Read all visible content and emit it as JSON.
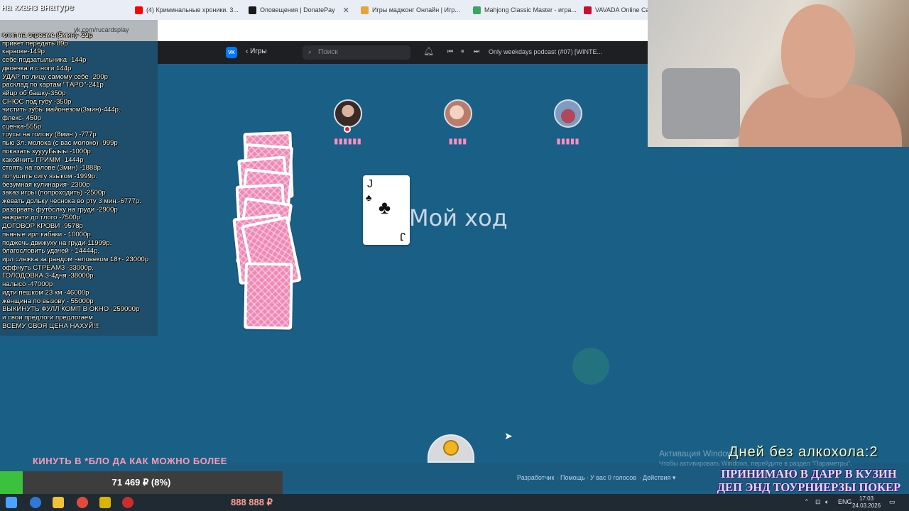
{
  "browser": {
    "tabs": [
      {
        "label": "клип на стрееме (5мин)- 29р",
        "favicon_color": "#5f6b78"
      },
      {
        "label": "(4) Криминальные хроники. 3...",
        "favicon_color": "#ff0000"
      },
      {
        "label": "Оповещения | DonatePay",
        "favicon_color": "#1a1a1a"
      },
      {
        "label": "Игры маджонг Онлайн | Игр...",
        "favicon_color": "#e8a33a"
      },
      {
        "label": "Mahjong Classic Master - игра...",
        "favicon_color": "#3aa55f"
      },
      {
        "label": "VAVADA Online Casi...",
        "favicon_color": "#c8102e"
      }
    ],
    "url": "vk.com/rucardsplay"
  },
  "vk_header": {
    "logo": "VK",
    "back_label": "Игры",
    "search_placeholder": "Поиск",
    "track": "Only weekdays podcast (#07) [WINTE..."
  },
  "game": {
    "players": [
      {
        "name": "▮▮▮▮▮▮",
        "active": true
      },
      {
        "name": "▮▮▮▮"
      },
      {
        "name": "▮▮▮▮▮"
      }
    ],
    "played_card": {
      "rank": "J",
      "suit": "♣"
    },
    "turn_label": "Мой ход"
  },
  "footer": {
    "links": [
      "Разработчик",
      "·",
      "Помощь",
      "·",
      "У вас 0 голосов",
      "·",
      "Действия ▾"
    ]
  },
  "stream_overlay": {
    "title": "на кханз внатуре",
    "price_list": [
      "клип на стрееме (5мин)- 29р",
      "привет передать 89р",
      "караоке-149р",
      "себе подзатыльника -144р",
      "двоечка и с ноги 144р",
      "УДАР по лицу самому себе -200р",
      "расклад по картам \"ТАРО\"-241р",
      "яйцо об башку-350р",
      "СНЮС под губу -350р",
      "чистить зубы майонезом(3мин)-444р.",
      "флекс- 450р",
      "сценка-555р",
      "трусы на голову (8мин ) -777р",
      "пью 3л. молока (с вас молоко) -999р",
      "показать зууууБыыы -1000р",
      "какойнить ГРИММ -1444р",
      "стоять на голове (3мин) -1888р.",
      "потушить сигу языком -1999р.",
      "безумная кулинария- 2300р",
      "заказ игры (попроходить) -2500р",
      "жевать дольку чеснока во рту 3 мин.-6777р.",
      "разорвать футболку на груди -2900р",
      "нажрати до тлого -7500р",
      "ДОГОВОР КРОВИ -9578р",
      "пьяные ирл кабаки - 10000р",
      "поджечь движуху на груди-11999р.",
      "благословить удачей - 14444р.",
      "ирл слежка за рандом человеком 18+- 23000р",
      "оффнуть СТРЕАМ3 -33000р.",
      "ГОЛОДОВКА 3-4дня -38000р.",
      "налысо -47000р",
      "идти пешком 23 км -46000р",
      "женщина по вызову - 55000р",
      "ВЫКИНУТЬ ФУЛЛ КОМП В ОКНО -259000р",
      "и свои предлоги предлогаем",
      "ВСЕМУ СВОЯ ЦЕНА НАХУЙ!!!"
    ],
    "ticker": "КИНУТЬ В *БЛО ДА КАК МОЖНО БОЛЕЕ",
    "goal": {
      "text": "71 469 ₽ (8%)",
      "percent": 8
    },
    "counter": "888 888 ₽",
    "alcohol": "Дней без алкохола:2",
    "darr": [
      "ПРИНИМАЮ В ДАРР В КУЗИН",
      "ДЕП ЭНД ТОУРНИЕРЗЫ ПОКЕР"
    ]
  },
  "windows": {
    "watermark": "Активация Windows",
    "watermark_sub": "Чтобы активировать Windows, перейдите в раздел \"Параметры\".",
    "lang": "ENG",
    "time": "17:03",
    "date": "24.03.2026"
  }
}
